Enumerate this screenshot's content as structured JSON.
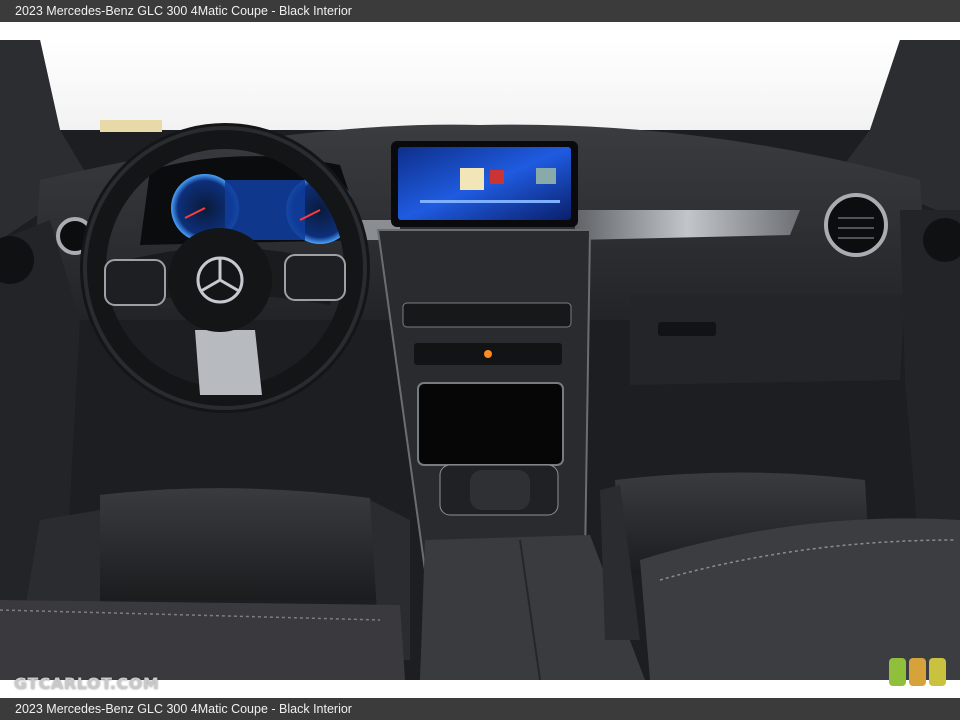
{
  "caption": "2023 Mercedes-Benz GLC 300 4Matic Coupe - Black Interior",
  "watermark": "GTCARLOT.COM",
  "colors": {
    "bar_bg": "#3b3b3b",
    "interior": "#1c1d20",
    "trim": "#9a9ea4",
    "screen": "#1a4cc8",
    "swatches": [
      "#8fbf3b",
      "#d6a23a",
      "#c9c23f"
    ]
  }
}
